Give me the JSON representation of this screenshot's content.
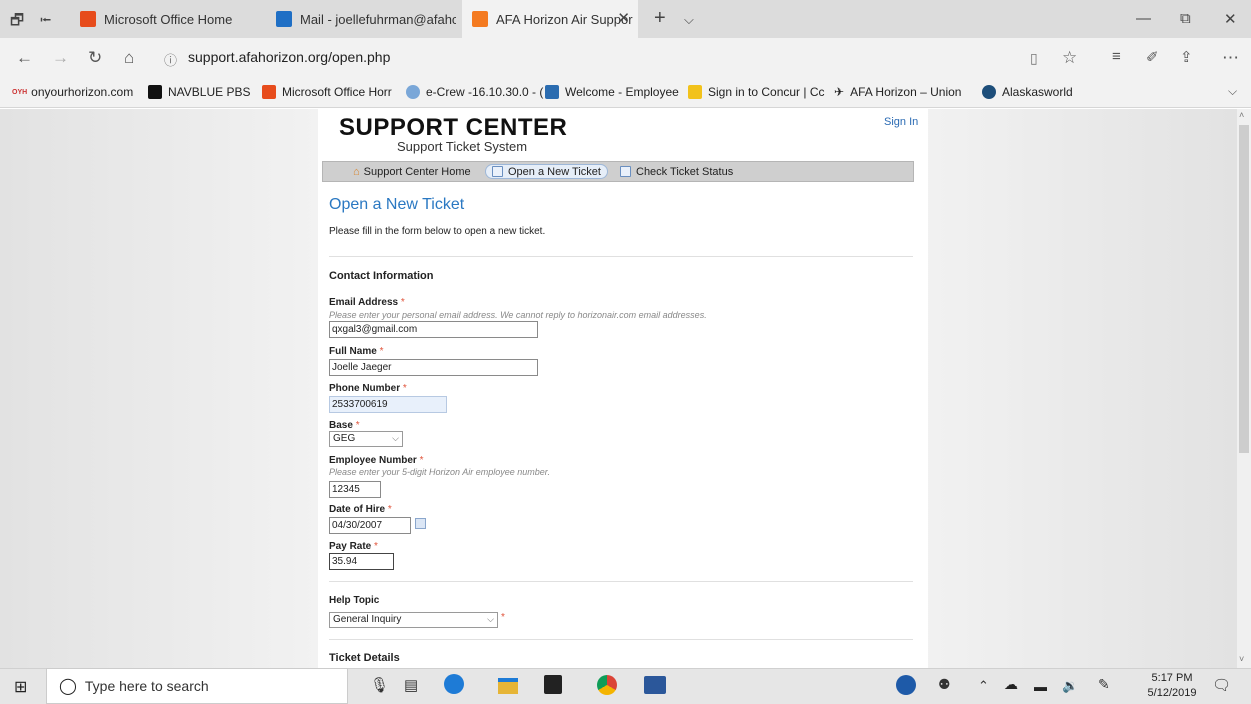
{
  "browser": {
    "tabs": [
      {
        "title": "Microsoft Office Home"
      },
      {
        "title": "Mail - joellefuhrman@afahc"
      },
      {
        "title": "AFA Horizon Air Suppor"
      }
    ],
    "url": "support.afahorizon.org/open.php",
    "favorites": [
      "onyourhorizon.com",
      "NAVBLUE PBS",
      "Microsoft Office Horr",
      "e-Crew -16.10.30.0 - (",
      "Welcome - Employee",
      "Sign in to Concur | Cc",
      "AFA Horizon – Union",
      "Alaskasworld"
    ],
    "favorites_prefix": "OYH"
  },
  "site": {
    "logo_title": "SUPPORT CENTER",
    "logo_subtitle": "Support Ticket System",
    "sign_in": "Sign In",
    "nav": [
      "Support Center Home",
      "Open a New Ticket",
      "Check Ticket Status"
    ]
  },
  "form": {
    "page_title": "Open a New Ticket",
    "intro": "Please fill in the form below to open a new ticket.",
    "contact_heading": "Contact Information",
    "required_mark": "*",
    "email_label": "Email Address",
    "email_hint": "Please enter your personal email address. We cannot reply to horizonair.com email addresses.",
    "email_value": "qxgal3@gmail.com",
    "name_label": "Full Name",
    "name_value": "Joelle Jaeger",
    "phone_label": "Phone Number",
    "phone_value": "2533700619",
    "base_label": "Base",
    "base_value": "GEG",
    "empnum_label": "Employee Number",
    "empnum_hint": "Please enter your 5-digit Horizon Air employee number.",
    "empnum_value": "12345",
    "doh_label": "Date of Hire",
    "doh_value": "04/30/2007",
    "pay_label": "Pay Rate",
    "pay_value": "35.94",
    "help_heading": "Help Topic",
    "help_value": "General Inquiry",
    "details_heading": "Ticket Details"
  },
  "taskbar": {
    "search_placeholder": "Type here to search",
    "time": "5:17 PM",
    "date": "5/12/2019"
  },
  "colors": {
    "link": "#2a78c2",
    "required": "#e0533a"
  }
}
